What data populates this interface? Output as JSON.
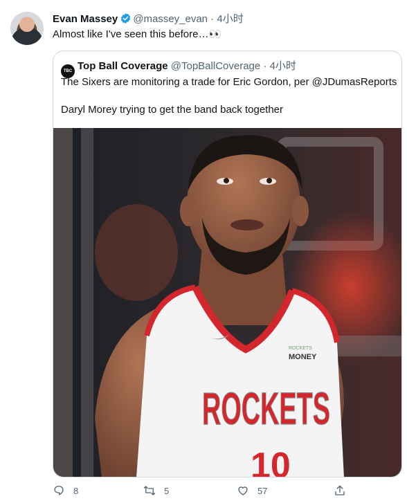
{
  "tweet": {
    "author_name": "Evan Massey",
    "author_handle": "@massey_evan",
    "separator": " · ",
    "time": "4小时",
    "text": "Almost like I've seen this before…👀"
  },
  "quoted": {
    "avatar_text": "TBC",
    "author_name": "Top Ball Coverage",
    "author_handle": "@TopBallCoverage",
    "separator": " · ",
    "time": "4小时",
    "line1": "The Sixers are monitoring a trade for Eric Gordon, per @JDumasReports",
    "line2": "Daryl Morey trying to get the band back together",
    "image": {
      "jersey_text": "ROCKETS",
      "sponsor_text": "MONEY",
      "sponsor_small": "ROCKETS",
      "number_text": "10"
    }
  },
  "actions": {
    "reply_count": "8",
    "retweet_count": "5",
    "like_count": "57"
  },
  "colors": {
    "verified": "#1d9bf0",
    "muted": "#536471",
    "jersey_red": "#d4272d"
  }
}
